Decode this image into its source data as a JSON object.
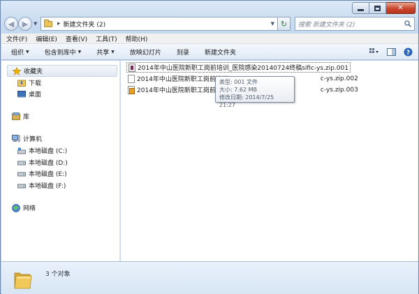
{
  "window": {
    "title": "新建文件夹 (2)"
  },
  "address": {
    "path": "新建文件夹 (2)"
  },
  "search": {
    "placeholder": "搜索 新建文件夹 (2)"
  },
  "menu": [
    "文件(F)",
    "编辑(E)",
    "查看(V)",
    "工具(T)",
    "帮助(H)"
  ],
  "commands": {
    "organize": "组织",
    "include_library": "包含到库中",
    "share": "共享",
    "slideshow": "放映幻灯片",
    "burn": "刻录",
    "new_folder": "新建文件夹"
  },
  "nav": {
    "favorites": "收藏夹",
    "downloads": "下载",
    "desktop": "桌面",
    "libraries": "库",
    "computer": "计算机",
    "drives": [
      "本地磁盘 (C:)",
      "本地磁盘 (D:)",
      "本地磁盘 (E:)",
      "本地磁盘 (F:)"
    ],
    "network": "网络"
  },
  "files": [
    "2014年中山医院新职工岗前培训_医院感染20140724终稿sific-ys.zip.001",
    "2014年中山医院新职工岗前培训",
    "2014年中山医院新职工岗前培训"
  ],
  "file_suffixes": [
    "",
    "c-ys.zip.002",
    "c-ys.zip.003"
  ],
  "tooltip": {
    "type": "类型: 001 文件",
    "size": "大小: 7.62 MB",
    "modified": "修改日期: 2014/7/25 21:27"
  },
  "status": {
    "count": "3 个对象"
  }
}
